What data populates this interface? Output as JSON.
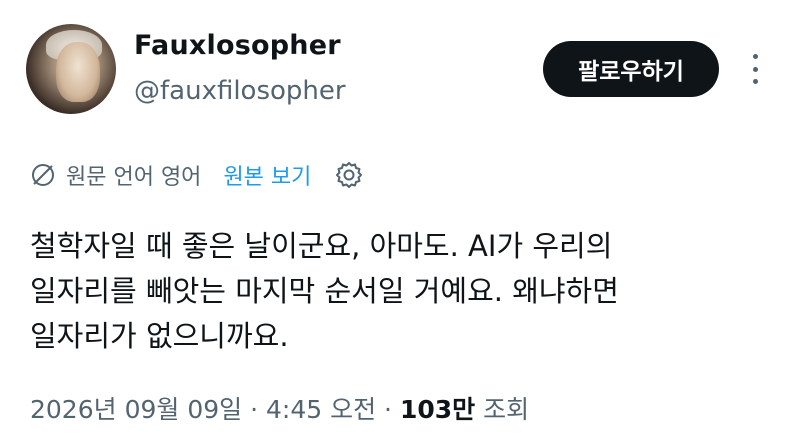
{
  "user": {
    "display_name": "Fauxlosopher",
    "handle": "@fauxfilosopher"
  },
  "follow_button": {
    "label": "팔로우하기"
  },
  "translation": {
    "language_note": "원문 언어 영어",
    "show_original_label": "원본 보기"
  },
  "tweet": {
    "lines": [
      "철학자일 때 좋은 날이군요, 아마도. AI가 우리의",
      "일자리를 빼앗는 마지막 순서일 거예요. 왜냐하면",
      "일자리가 없으니까요."
    ]
  },
  "meta": {
    "date": "2026년 09월 09일",
    "separator1": "·",
    "time": "4:45 오전",
    "separator2": "·",
    "views_count": "103만",
    "views_label": "조회"
  },
  "icons": {
    "translate": "globe-slash-icon",
    "settings": "gear-icon",
    "more": "more-vertical-icon"
  },
  "colors": {
    "text_primary": "#0f1419",
    "text_secondary": "#536471",
    "link": "#1d9bf0",
    "button_bg": "#0f1419"
  }
}
